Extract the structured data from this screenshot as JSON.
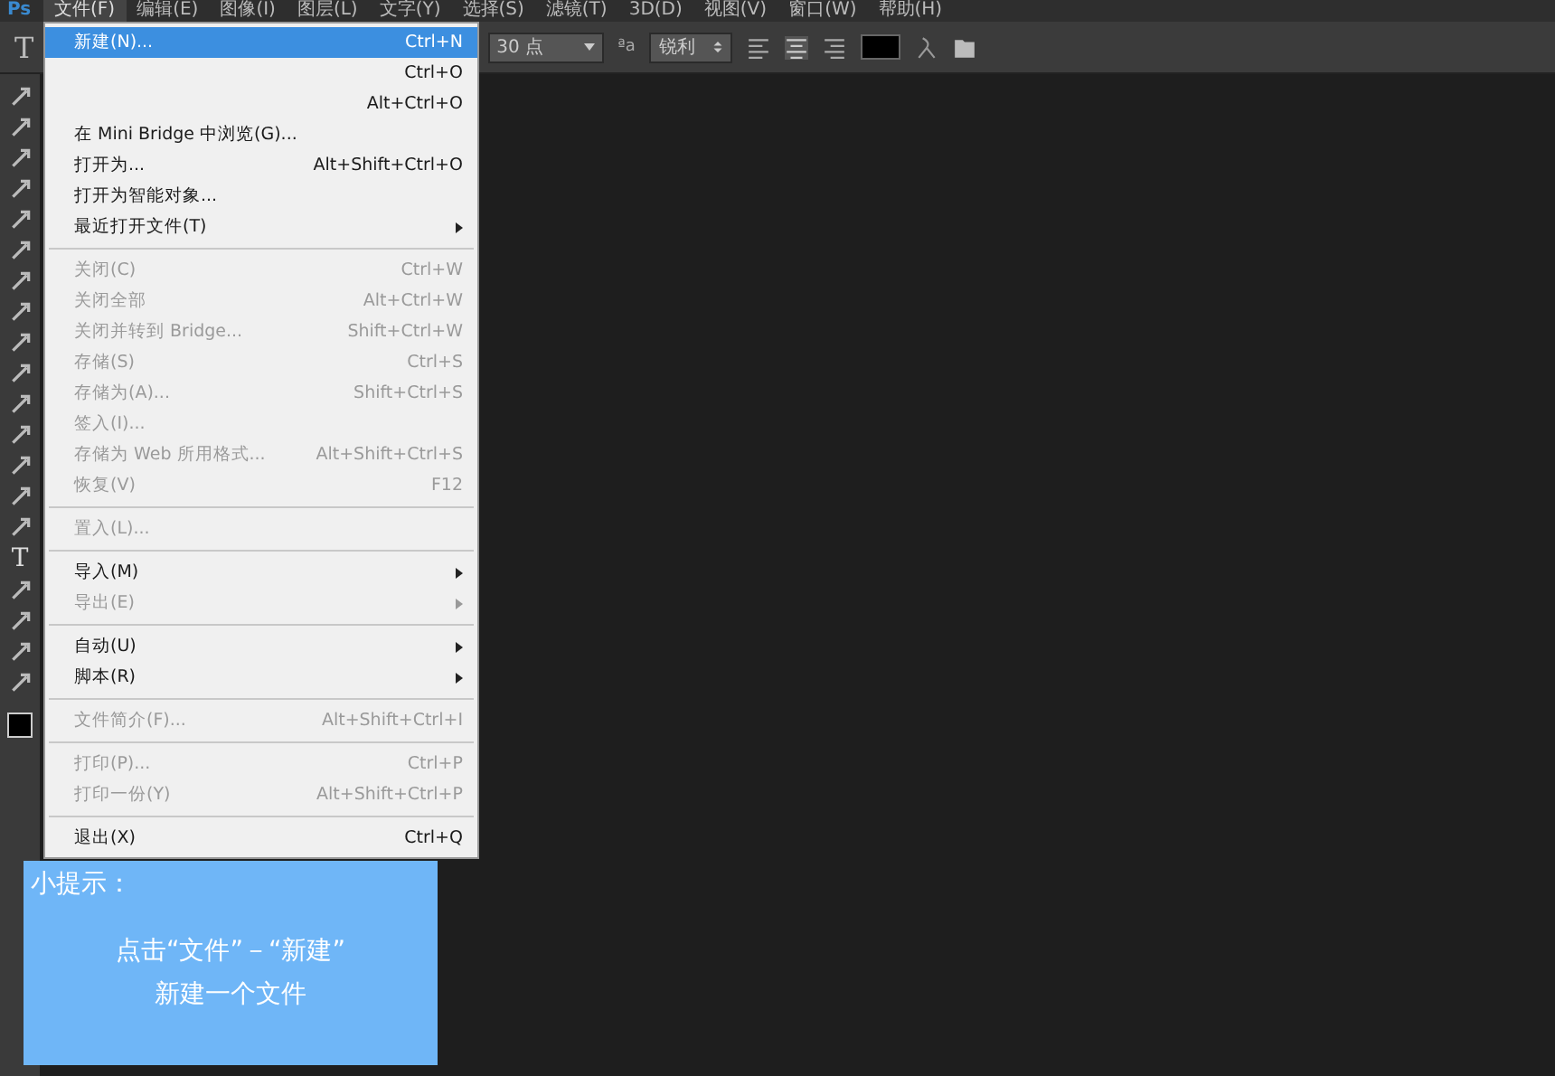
{
  "menu_bar": {
    "logo": "Ps",
    "items": [
      {
        "label": "文件(F)",
        "selected": true
      },
      {
        "label": "编辑(E)",
        "selected": false
      },
      {
        "label": "图像(I)",
        "selected": false
      },
      {
        "label": "图层(L)",
        "selected": false
      },
      {
        "label": "文字(Y)",
        "selected": false
      },
      {
        "label": "选择(S)",
        "selected": false
      },
      {
        "label": "滤镜(T)",
        "selected": false
      },
      {
        "label": "3D(D)",
        "selected": false
      },
      {
        "label": "视图(V)",
        "selected": false
      },
      {
        "label": "窗口(W)",
        "selected": false
      },
      {
        "label": "帮助(H)",
        "selected": false
      }
    ]
  },
  "options_bar": {
    "tool_glyph": "T",
    "font_size": "30 点",
    "antialias_icon": "ªa",
    "antialias": "锐利"
  },
  "toolbar": {
    "type_tool": "T"
  },
  "file_menu": [
    {
      "kind": "item",
      "label": "新建(N)...",
      "shortcut": "Ctrl+N",
      "disabled": false,
      "submenu": false,
      "selected": true
    },
    {
      "kind": "item",
      "shortcut": "Ctrl+O",
      "disabled": false,
      "submenu": false,
      "selected": false
    },
    {
      "kind": "item",
      "shortcut": "Alt+Ctrl+O",
      "disabled": false,
      "submenu": false,
      "selected": false
    },
    {
      "kind": "item",
      "label": "在 Mini Bridge 中浏览(G)...",
      "disabled": false,
      "submenu": false,
      "selected": false
    },
    {
      "kind": "item",
      "label": "打开为...",
      "shortcut": "Alt+Shift+Ctrl+O",
      "disabled": false,
      "submenu": false,
      "selected": false
    },
    {
      "kind": "item",
      "label": "打开为智能对象...",
      "disabled": false,
      "submenu": false,
      "selected": false
    },
    {
      "kind": "item",
      "label": "最近打开文件(T)",
      "disabled": false,
      "submenu": true,
      "selected": false
    },
    {
      "kind": "separator"
    },
    {
      "kind": "item",
      "label": "关闭(C)",
      "shortcut": "Ctrl+W",
      "disabled": true,
      "submenu": false,
      "selected": false
    },
    {
      "kind": "item",
      "label": "关闭全部",
      "shortcut": "Alt+Ctrl+W",
      "disabled": true,
      "submenu": false,
      "selected": false
    },
    {
      "kind": "item",
      "label": "关闭并转到 Bridge...",
      "shortcut": "Shift+Ctrl+W",
      "disabled": true,
      "submenu": false,
      "selected": false
    },
    {
      "kind": "item",
      "label": "存储(S)",
      "shortcut": "Ctrl+S",
      "disabled": true,
      "submenu": false,
      "selected": false
    },
    {
      "kind": "item",
      "label": "存储为(A)...",
      "shortcut": "Shift+Ctrl+S",
      "disabled": true,
      "submenu": false,
      "selected": false
    },
    {
      "kind": "item",
      "label": "签入(I)...",
      "disabled": true,
      "submenu": false,
      "selected": false
    },
    {
      "kind": "item",
      "label": "存储为 Web 所用格式...",
      "shortcut": "Alt+Shift+Ctrl+S",
      "disabled": true,
      "submenu": false,
      "selected": false
    },
    {
      "kind": "item",
      "label": "恢复(V)",
      "shortcut": "F12",
      "disabled": true,
      "submenu": false,
      "selected": false
    },
    {
      "kind": "separator"
    },
    {
      "kind": "item",
      "label": "置入(L)...",
      "disabled": true,
      "submenu": false,
      "selected": false
    },
    {
      "kind": "separator"
    },
    {
      "kind": "item",
      "label": "导入(M)",
      "disabled": false,
      "submenu": true,
      "selected": false
    },
    {
      "kind": "item",
      "label": "导出(E)",
      "disabled": true,
      "submenu": true,
      "selected": false
    },
    {
      "kind": "separator"
    },
    {
      "kind": "item",
      "label": "自动(U)",
      "disabled": false,
      "submenu": true,
      "selected": false
    },
    {
      "kind": "item",
      "label": "脚本(R)",
      "disabled": false,
      "submenu": true,
      "selected": false
    },
    {
      "kind": "separator"
    },
    {
      "kind": "item",
      "label": "文件简介(F)...",
      "shortcut": "Alt+Shift+Ctrl+I",
      "disabled": true,
      "submenu": false,
      "selected": false
    },
    {
      "kind": "separator"
    },
    {
      "kind": "item",
      "label": "打印(P)...",
      "shortcut": "Ctrl+P",
      "disabled": true,
      "submenu": false,
      "selected": false
    },
    {
      "kind": "item",
      "label": "打印一份(Y)",
      "shortcut": "Alt+Shift+Ctrl+P",
      "disabled": true,
      "submenu": false,
      "selected": false
    },
    {
      "kind": "separator"
    },
    {
      "kind": "item",
      "label": "退出(X)",
      "shortcut": "Ctrl+Q",
      "disabled": false,
      "submenu": false,
      "selected": false
    }
  ],
  "tip_box": {
    "title": "小提示：",
    "lines": [
      "点击“文件”－“新建”",
      "新建一个文件"
    ]
  }
}
